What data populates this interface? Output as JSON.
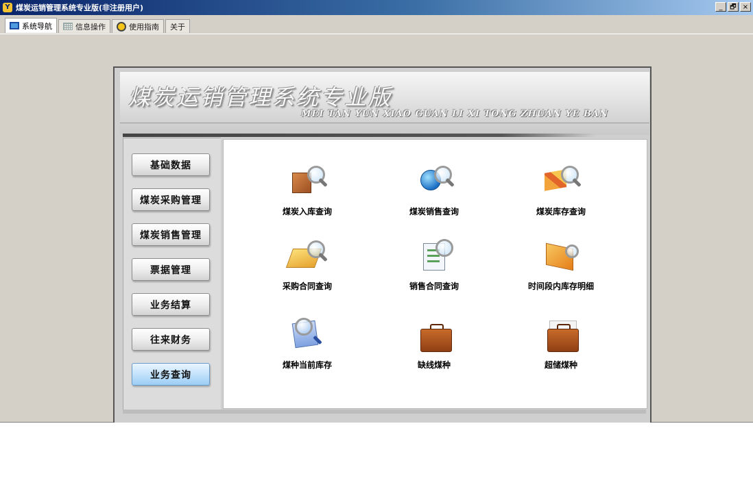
{
  "window": {
    "title": "煤炭运销管理系统专业版(非注册用户)",
    "controls": {
      "minimize": "_",
      "restore": "🗗",
      "close": "×"
    }
  },
  "tabs": [
    {
      "label": "系统导航",
      "icon": "nav-icon",
      "active": true
    },
    {
      "label": "信息操作",
      "icon": "grid-icon",
      "active": false
    },
    {
      "label": "使用指南",
      "icon": "guide-icon",
      "active": false
    },
    {
      "label": "关于",
      "icon": "",
      "active": false
    }
  ],
  "banner": {
    "title": "煤炭运销管理系统专业版",
    "subtitle": "MEI TAN YUN XIAO GUAN LI XI TONG ZHUAN YE BAN"
  },
  "sidebar": {
    "items": [
      {
        "label": "基础数据"
      },
      {
        "label": "煤炭采购管理"
      },
      {
        "label": "煤炭销售管理"
      },
      {
        "label": "票据管理"
      },
      {
        "label": "业务结算"
      },
      {
        "label": "往来财务"
      },
      {
        "label": "业务查询",
        "active": true
      }
    ]
  },
  "main": {
    "items": [
      {
        "label": "煤炭入库查询",
        "icon": "box-search-icon"
      },
      {
        "label": "煤炭销售查询",
        "icon": "globe-search-icon"
      },
      {
        "label": "煤炭库存查询",
        "icon": "cubes-search-icon"
      },
      {
        "label": "采购合同查询",
        "icon": "folder-search-icon"
      },
      {
        "label": "销售合同查询",
        "icon": "document-search-icon"
      },
      {
        "label": "时间段内库存明细",
        "icon": "panel-chart-icon"
      },
      {
        "label": "煤种当前库存",
        "icon": "search-document-icon"
      },
      {
        "label": "缺线煤种",
        "icon": "briefcase-icon"
      },
      {
        "label": "超储煤种",
        "icon": "briefcase-papers-icon"
      }
    ]
  }
}
